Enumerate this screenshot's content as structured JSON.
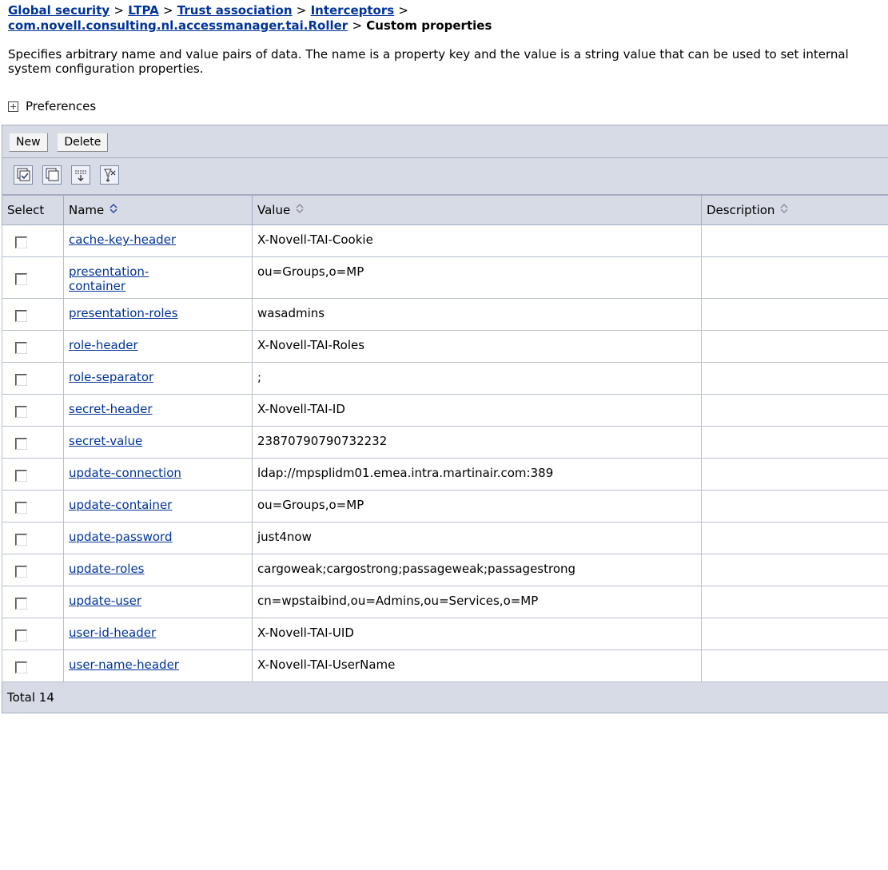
{
  "breadcrumb": {
    "items": [
      "Global security",
      "LTPA",
      "Trust association",
      "Interceptors",
      "com.novell.consulting.nl.accessmanager.tai.Roller"
    ],
    "current": "Custom properties",
    "separator": ">"
  },
  "description": "Specifies arbitrary name and value pairs of data. The name is a property key and the value is a string value that can be used to set internal system configuration properties.",
  "preferences_label": "Preferences",
  "toolbar": {
    "new_label": "New",
    "delete_label": "Delete"
  },
  "icon_toolbar": [
    "select-all-icon",
    "deselect-all-icon",
    "show-filter-icon",
    "clear-filter-icon"
  ],
  "table": {
    "headers": {
      "select": "Select",
      "name": "Name",
      "value": "Value",
      "description": "Description"
    },
    "rows": [
      {
        "name": "cache-key-header",
        "value": "X-Novell-TAI-Cookie",
        "description": ""
      },
      {
        "name": "presentation-container",
        "value": "ou=Groups,o=MP",
        "description": ""
      },
      {
        "name": "presentation-roles",
        "value": "wasadmins",
        "description": ""
      },
      {
        "name": "role-header",
        "value": "X-Novell-TAI-Roles",
        "description": ""
      },
      {
        "name": "role-separator",
        "value": ";",
        "description": ""
      },
      {
        "name": "secret-header",
        "value": "X-Novell-TAI-ID",
        "description": ""
      },
      {
        "name": "secret-value",
        "value": "23870790790732232",
        "description": ""
      },
      {
        "name": "update-connection",
        "value": "ldap://mpsplidm01.emea.intra.martinair.com:389",
        "description": ""
      },
      {
        "name": "update-container",
        "value": "ou=Groups,o=MP",
        "description": ""
      },
      {
        "name": "update-password",
        "value": "just4now",
        "description": ""
      },
      {
        "name": "update-roles",
        "value": "cargoweak;cargostrong;passageweak;passagestrong",
        "description": ""
      },
      {
        "name": "update-user",
        "value": "cn=wpstaibind,ou=Admins,ou=Services,o=MP",
        "description": ""
      },
      {
        "name": "user-id-header",
        "value": "X-Novell-TAI-UID",
        "description": ""
      },
      {
        "name": "user-name-header",
        "value": "X-Novell-TAI-UserName",
        "description": ""
      }
    ]
  },
  "total_label": "Total 14",
  "colors": {
    "link": "#003399",
    "bar_bg": "#d7dbe6",
    "border": "#a3acc0"
  }
}
